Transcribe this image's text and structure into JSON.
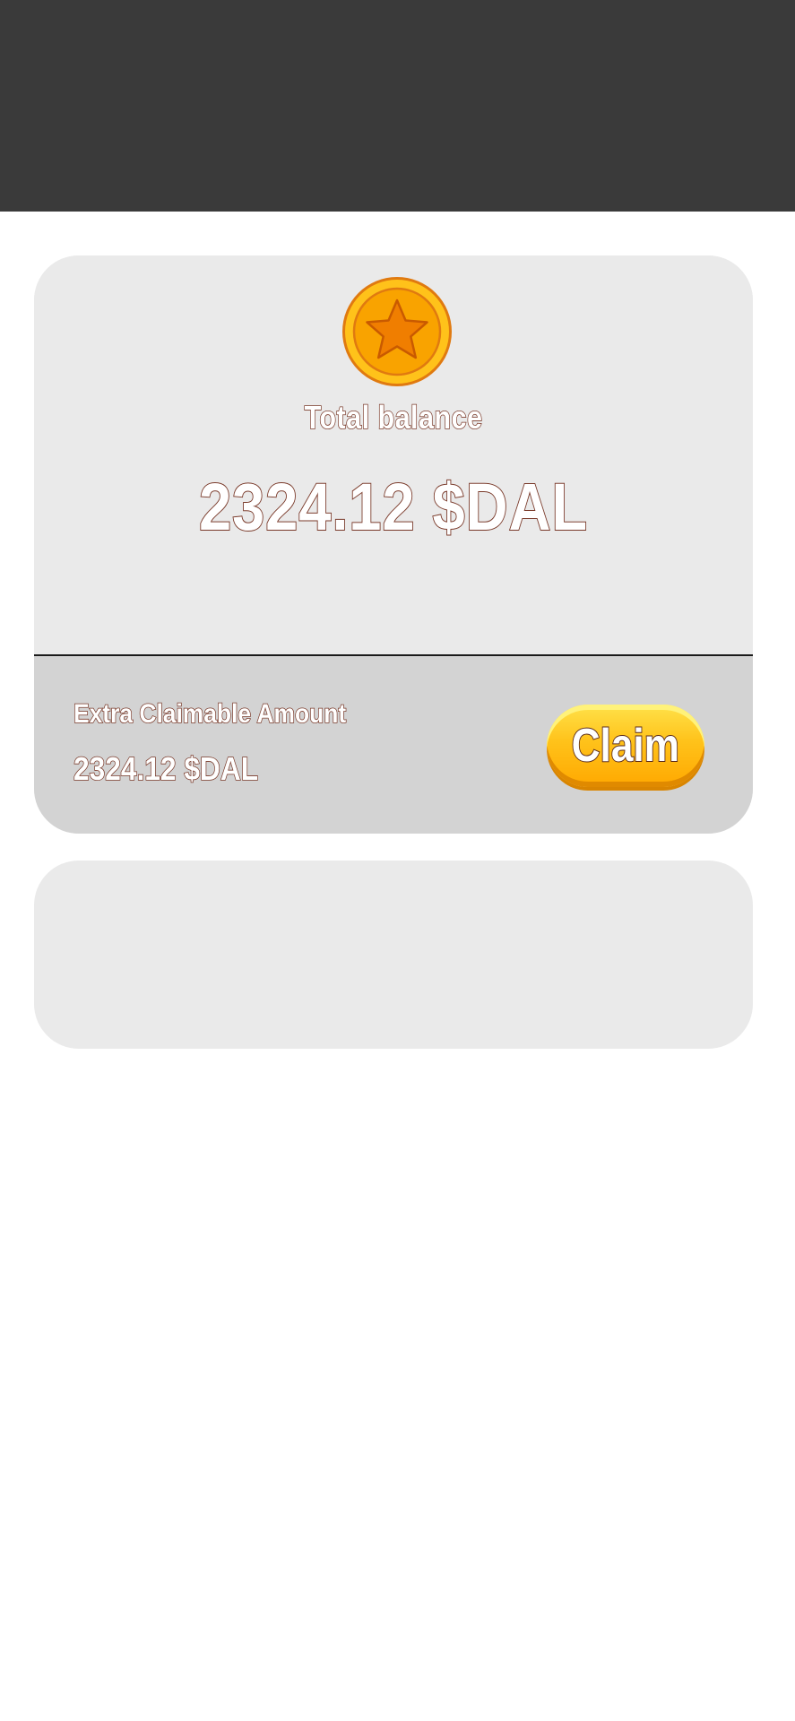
{
  "balance_card": {
    "coin_icon": "star-coin-icon",
    "label": "Total balance",
    "amount": "2324.12 $DAL"
  },
  "claim_section": {
    "label": "Extra Claimable Amount",
    "amount": "2324.12 $DAL",
    "button_label": "Claim"
  },
  "colors": {
    "header_bg": "#3a3a3a",
    "card_bg": "#eaeaea",
    "claim_section_bg": "#d3d3d3",
    "accent_gold": "#ffc21a",
    "text_outline": "#7a3a2a"
  }
}
